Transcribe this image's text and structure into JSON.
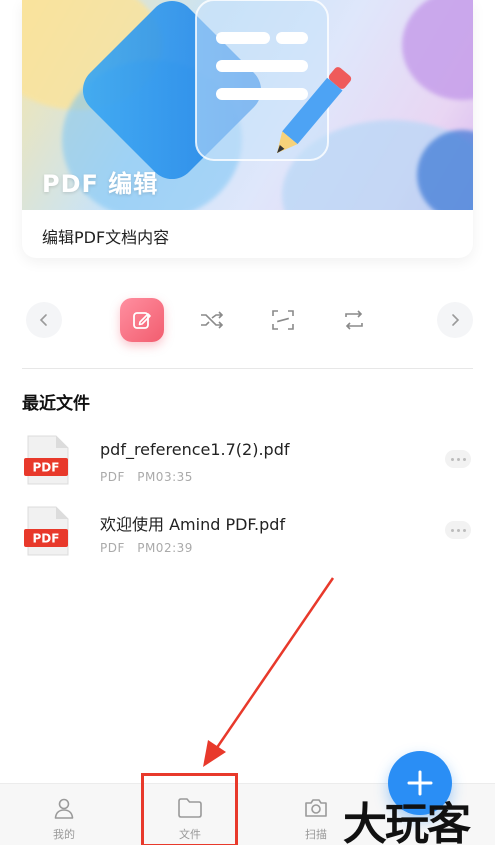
{
  "banner": {
    "title": "PDF 编辑",
    "caption": "编辑PDF文档内容"
  },
  "tools": [
    {
      "icon": "chevron-left-icon"
    },
    {
      "icon": "edit-icon",
      "active": true
    },
    {
      "icon": "shuffle-icon"
    },
    {
      "icon": "scan-frame-icon"
    },
    {
      "icon": "convert-icon"
    },
    {
      "icon": "chevron-right-icon"
    }
  ],
  "recent": {
    "title": "最近文件",
    "files": [
      {
        "badge": "PDF",
        "name": "pdf_reference1.7(2).pdf",
        "type": "PDF",
        "time": "PM03:35"
      },
      {
        "badge": "PDF",
        "name": "欢迎使用 Amind PDF.pdf",
        "type": "PDF",
        "time": "PM02:39"
      }
    ]
  },
  "bottom_nav": {
    "items": [
      {
        "label": "我的",
        "icon": "user-icon"
      },
      {
        "label": "文件",
        "icon": "folder-icon"
      },
      {
        "label": "扫描",
        "icon": "camera-icon"
      }
    ]
  },
  "fab": {
    "symbol": "+"
  },
  "watermark": "大玩客",
  "colors": {
    "accent": "#2a8ef5",
    "pdf_red": "#e8392b",
    "annotation_red": "#e8392b",
    "edit_pink": "#f25d6f"
  }
}
